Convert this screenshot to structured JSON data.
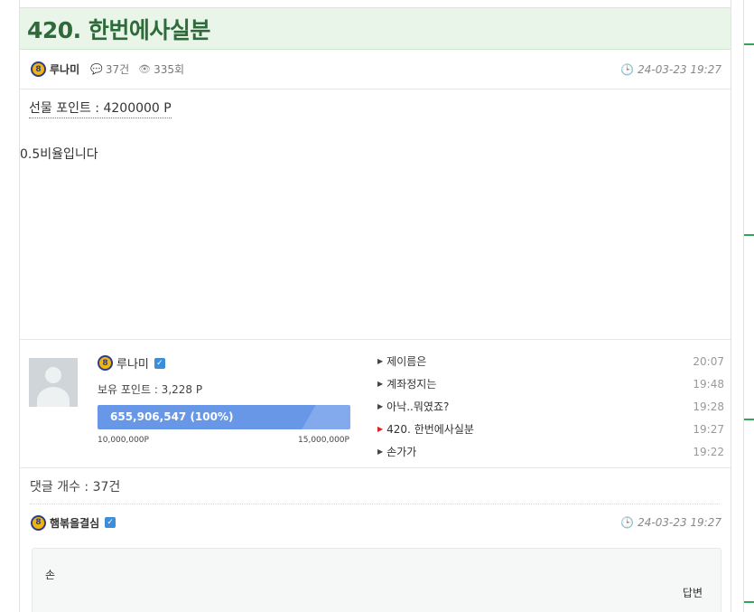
{
  "post": {
    "title": "420. 한번에사실분",
    "level_badge": "8",
    "author": "루나미",
    "comment_count": "37건",
    "view_count": "335회",
    "date": "24-03-23 19:27"
  },
  "content": {
    "gift_line": "선물 포인트 : 4200000 P",
    "body": "0.5비율입니다"
  },
  "profile": {
    "level_badge": "8",
    "name": "루나미",
    "points": "보유 포인트 : 3,228 P",
    "progress_text": "655,906,547 (100%)",
    "progress_fraction": 1.0,
    "progress_min": "10,000,000P",
    "progress_max": "15,000,000P"
  },
  "recent_posts": [
    {
      "title": "제이름은",
      "time": "20:07",
      "active": false
    },
    {
      "title": "계좌정지는",
      "time": "19:48",
      "active": false
    },
    {
      "title": "아낙..뭐였죠?",
      "time": "19:28",
      "active": false
    },
    {
      "title": "420. 한번에사실분",
      "time": "19:27",
      "active": true
    },
    {
      "title": "손가가",
      "time": "19:22",
      "active": false
    }
  ],
  "comments": {
    "header": "댓글 개수 : 37건",
    "first": {
      "level_badge": "8",
      "name": "햄볶을결심",
      "date": "24-03-23 19:27",
      "text": "손",
      "reply_label": "답변"
    }
  },
  "icons": {
    "comment": "speech-bubble-icon",
    "views": "eye-icon",
    "clock": "clock-icon",
    "verified": "check-badge-icon",
    "arrow": "triangle-right-icon"
  },
  "colors": {
    "title_bg": "#e9f5e9",
    "title_text": "#2f6b3a",
    "progress_bar": "#6897e8",
    "active_arrow": "#e02020",
    "verified": "#3d8ed8",
    "right_accent": "#3aa35a"
  }
}
